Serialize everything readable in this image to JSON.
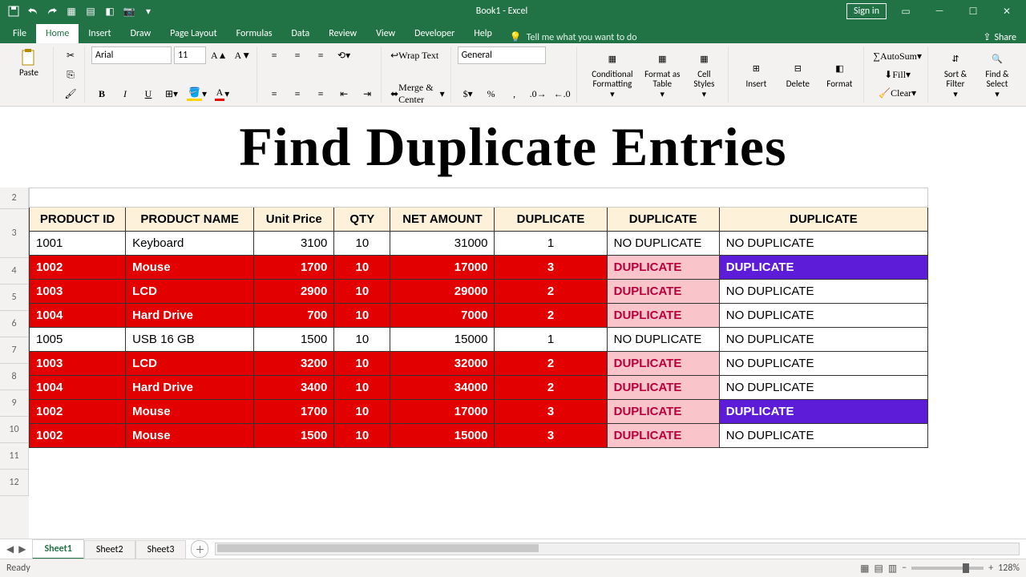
{
  "title": "Book1 - Excel",
  "signin": "Sign in",
  "tabs": [
    "File",
    "Home",
    "Insert",
    "Draw",
    "Page Layout",
    "Formulas",
    "Data",
    "Review",
    "View",
    "Developer",
    "Help"
  ],
  "tell": "Tell me what you want to do",
  "share": "Share",
  "font": {
    "name": "Arial",
    "size": "11"
  },
  "numfmt": "General",
  "rlabels": {
    "paste": "Paste",
    "wrap": "Wrap Text",
    "merge": "Merge & Center",
    "cond": "Conditional Formatting",
    "fat": "Format as Table",
    "cell": "Cell Styles",
    "ins": "Insert",
    "del": "Delete",
    "fmt": "Format",
    "asum": "AutoSum",
    "fill": "Fill",
    "clear": "Clear",
    "sort": "Sort & Filter",
    "find": "Find & Select"
  },
  "hero": "Find Duplicate Entries",
  "rows_idx": [
    "2",
    "3",
    "4",
    "5",
    "6",
    "7",
    "8",
    "9",
    "10",
    "11",
    "12"
  ],
  "headers": [
    "PRODUCT ID",
    "PRODUCT NAME",
    "Unit Price",
    "QTY",
    "NET AMOUNT",
    "DUPLICATE",
    "DUPLICATE",
    "DUPLICATE"
  ],
  "data": [
    {
      "r": 4,
      "hl": 0,
      "id": "1001",
      "name": "Keyboard",
      "up": "3100",
      "qty": "10",
      "net": "31000",
      "d1": "1",
      "d2": "NO DUPLICATE",
      "d3": "NO DUPLICATE",
      "d3c": ""
    },
    {
      "r": 5,
      "hl": 1,
      "id": "1002",
      "name": "Mouse",
      "up": "1700",
      "qty": "10",
      "net": "17000",
      "d1": "3",
      "d2": "DUPLICATE",
      "d3": "DUPLICATE",
      "d3c": "purple"
    },
    {
      "r": 6,
      "hl": 1,
      "id": "1003",
      "name": "LCD",
      "up": "2900",
      "qty": "10",
      "net": "29000",
      "d1": "2",
      "d2": "DUPLICATE",
      "d3": "NO DUPLICATE",
      "d3c": ""
    },
    {
      "r": 7,
      "hl": 1,
      "id": "1004",
      "name": "Hard Drive",
      "up": "700",
      "qty": "10",
      "net": "7000",
      "d1": "2",
      "d2": "DUPLICATE",
      "d3": "NO DUPLICATE",
      "d3c": ""
    },
    {
      "r": 8,
      "hl": 0,
      "id": "1005",
      "name": "USB 16 GB",
      "up": "1500",
      "qty": "10",
      "net": "15000",
      "d1": "1",
      "d2": "NO DUPLICATE",
      "d3": "NO DUPLICATE",
      "d3c": ""
    },
    {
      "r": 9,
      "hl": 1,
      "id": "1003",
      "name": "LCD",
      "up": "3200",
      "qty": "10",
      "net": "32000",
      "d1": "2",
      "d2": "DUPLICATE",
      "d3": "NO DUPLICATE",
      "d3c": ""
    },
    {
      "r": 10,
      "hl": 1,
      "id": "1004",
      "name": "Hard Drive",
      "up": "3400",
      "qty": "10",
      "net": "34000",
      "d1": "2",
      "d2": "DUPLICATE",
      "d3": "NO DUPLICATE",
      "d3c": ""
    },
    {
      "r": 11,
      "hl": 1,
      "id": "1002",
      "name": "Mouse",
      "up": "1700",
      "qty": "10",
      "net": "17000",
      "d1": "3",
      "d2": "DUPLICATE",
      "d3": "DUPLICATE",
      "d3c": "purple"
    },
    {
      "r": 12,
      "hl": 1,
      "id": "1002",
      "name": "Mouse",
      "up": "1500",
      "qty": "10",
      "net": "15000",
      "d1": "3",
      "d2": "DUPLICATE",
      "d3": "NO DUPLICATE",
      "d3c": ""
    }
  ],
  "sheets": [
    "Sheet1",
    "Sheet2",
    "Sheet3"
  ],
  "status": "Ready",
  "zoom": "128%"
}
